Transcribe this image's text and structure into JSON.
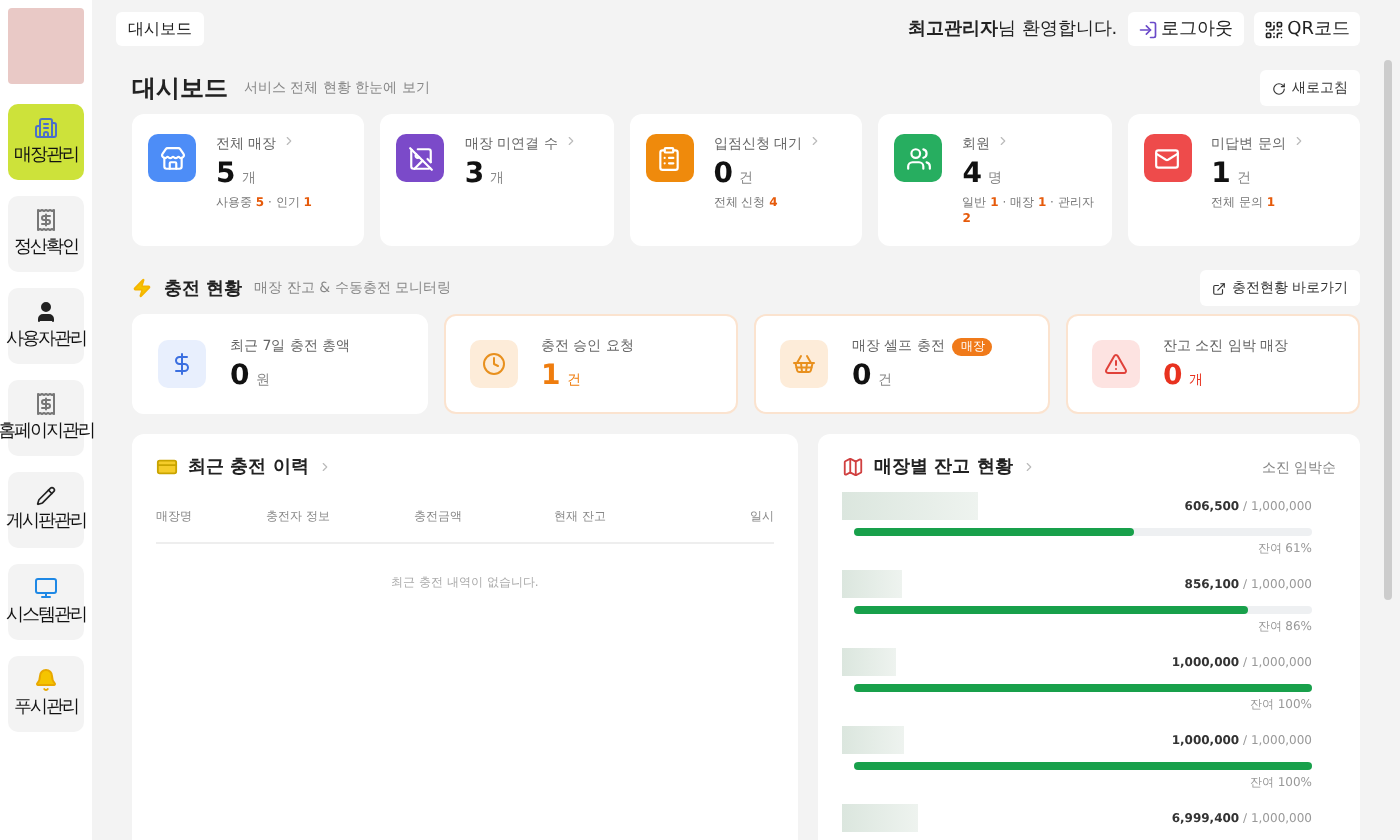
{
  "sidebar": {
    "items": [
      {
        "label": "매장관리",
        "selected": true
      },
      {
        "label": "정산확인",
        "selected": false
      },
      {
        "label": "사용자관리",
        "selected": false
      },
      {
        "label": "홈페이지관리",
        "selected": false
      },
      {
        "label": "게시판관리",
        "selected": false
      },
      {
        "label": "시스템관리",
        "selected": false
      },
      {
        "label": "푸시관리",
        "selected": false
      }
    ]
  },
  "breadcrumb": "대시보드",
  "header": {
    "user": "최고관리자",
    "welcome": "님 환영합니다.",
    "buttons": [
      {
        "label": "로그아웃",
        "kind": "logout"
      },
      {
        "label": "QR코드",
        "kind": "qr"
      }
    ]
  },
  "page": {
    "title": "대시보드",
    "subtitle": "서비스 전체 현황 한눈에 보기",
    "refresh": "새로고침"
  },
  "stats": [
    {
      "kind": "store",
      "label": "전체 매장",
      "value": "5",
      "unit": "개",
      "detail": "사용중 **5** · 인기 **1**"
    },
    {
      "kind": "unlinked",
      "label": "매장 미연결 수",
      "value": "3",
      "unit": "개"
    },
    {
      "kind": "clipboard",
      "label": "입점신청 대기",
      "value": "0",
      "unit": "건",
      "detail": "전체 신청 **4**"
    },
    {
      "kind": "members",
      "label": "회원",
      "value": "4",
      "unit": "명",
      "detail": "일반 **1** · 매장 **1** · 관리자 **2**"
    },
    {
      "kind": "mail",
      "label": "미답변 문의",
      "value": "1",
      "unit": "건",
      "detail": "전체 문의 **1**"
    }
  ],
  "charge": {
    "title": "충전 현황",
    "subtitle": "매장 잔고 & 수동충전 모니터링",
    "link": "충전현황 바로가기",
    "cards": [
      {
        "kind": "money",
        "label": "최근 7일 충전 총액",
        "value": "0",
        "unit": "원"
      },
      {
        "kind": "clock",
        "label": "충전 승인 요청",
        "value": "1",
        "unit": "건"
      },
      {
        "kind": "bag",
        "label": "매장 셀프 충전",
        "badge": "매장",
        "value": "0",
        "unit": "건"
      },
      {
        "kind": "alert",
        "label": "잔고 소진 임박 매장",
        "value": "0",
        "unit": "개"
      }
    ]
  },
  "history": {
    "title": "최근 충전 이력",
    "columns": [
      "매장명",
      "충전자 정보",
      "충전금액",
      "현재 잔고",
      "일시"
    ],
    "empty": "최근 충전 내역이 없습니다."
  },
  "balances": {
    "title": "매장별 잔고 현황",
    "sort": "소진 임박순",
    "rows": [
      {
        "amount": "606,500",
        "total": "/ 1,000,000",
        "level": 0.61,
        "remain": "잔여 61%"
      },
      {
        "amount": "856,100",
        "total": "/ 1,000,000",
        "level": 0.86,
        "remain": "잔여 86%"
      },
      {
        "amount": "1,000,000",
        "total": "/ 1,000,000",
        "level": 1,
        "remain": "잔여 100%"
      },
      {
        "amount": "1,000,000",
        "total": "/ 1,000,000",
        "level": 1,
        "remain": "잔여 100%"
      },
      {
        "amount": "6,999,400",
        "total": "/ 1,000,000"
      }
    ]
  }
}
